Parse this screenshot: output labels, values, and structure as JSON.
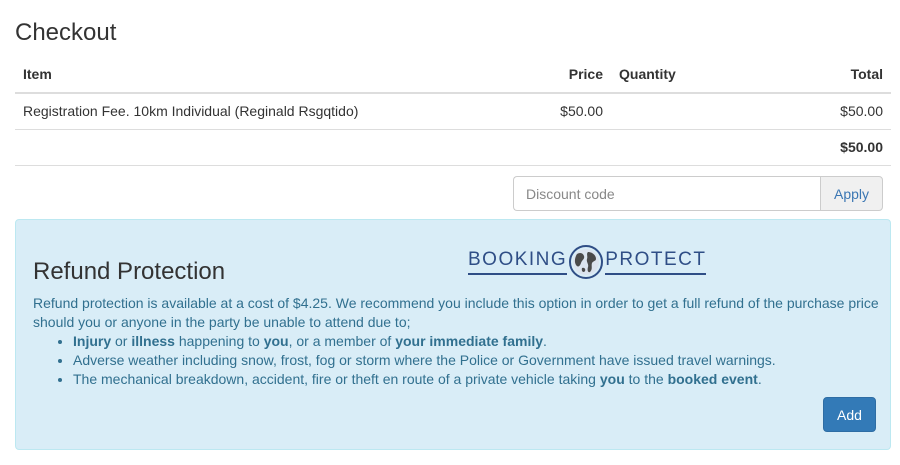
{
  "page": {
    "title": "Checkout"
  },
  "cart": {
    "headers": {
      "item": "Item",
      "price": "Price",
      "quantity": "Quantity",
      "total": "Total"
    },
    "rows": [
      {
        "item": "Registration Fee. 10km Individual (Reginald Rsgqtido)",
        "price": "$50.00",
        "quantity": "",
        "total": "$50.00"
      }
    ],
    "grand_total": "$50.00"
  },
  "discount": {
    "placeholder": "Discount code",
    "value": "",
    "apply_label": "Apply"
  },
  "refund": {
    "title": "Refund Protection",
    "logo": {
      "left_text": "BOOKING",
      "right_text": "PROTECT",
      "globe_icon": "globe-icon"
    },
    "description": "Refund protection is available at a cost of $4.25. We recommend you include this option in order to get a full refund of the purchase price should you or anyone in the party be unable to attend due to;",
    "bullets": [
      {
        "parts": [
          "Injury",
          " or ",
          "illness",
          " happening to ",
          "you",
          ", or a member of ",
          "your immediate family",
          "."
        ]
      },
      {
        "text": "Adverse weather including snow, frost, fog or storm where the Police or Government have issued travel warnings."
      },
      {
        "parts": [
          "The mechanical breakdown, accident, fire or theft en route of a private vehicle taking ",
          "you",
          " to the ",
          "booked event",
          "."
        ]
      }
    ],
    "add_label": "Add"
  },
  "colors": {
    "panel_bg": "#d9edf7",
    "panel_text": "#31708f",
    "primary_button": "#337ab7",
    "logo_blue": "#2f4e86"
  }
}
